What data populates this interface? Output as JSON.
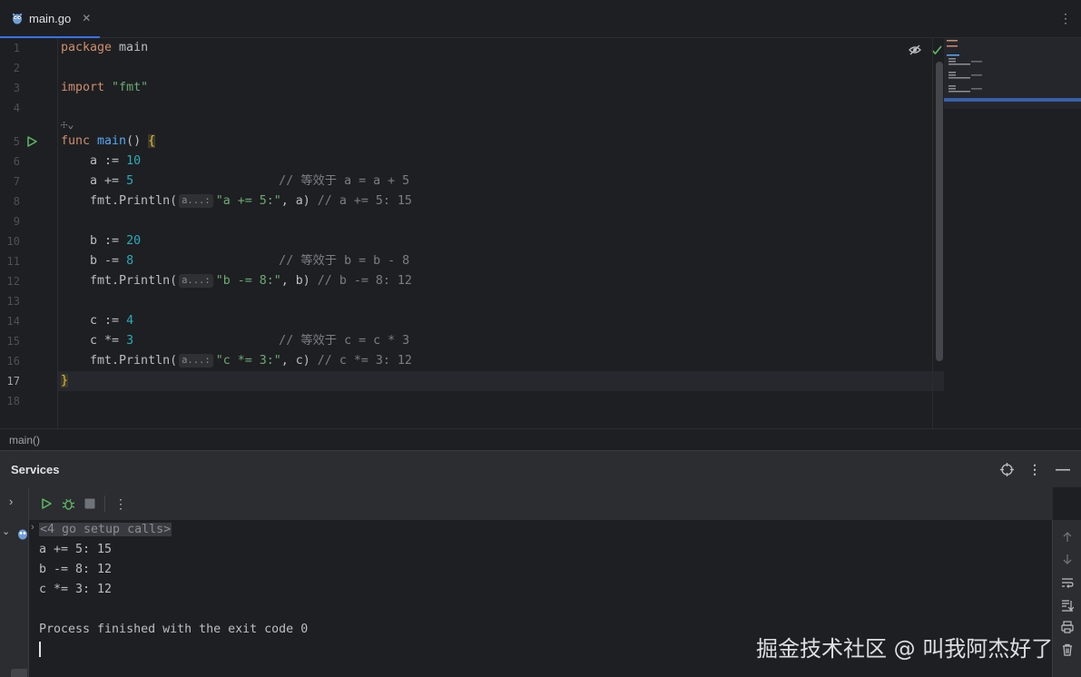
{
  "tab": {
    "filename": "main.go"
  },
  "editor": {
    "author_hint": "☩⌄",
    "lines": [
      {
        "n": "1"
      },
      {
        "n": "2"
      },
      {
        "n": "3"
      },
      {
        "n": "4"
      },
      {
        "n": "5"
      },
      {
        "n": "6"
      },
      {
        "n": "7"
      },
      {
        "n": "8"
      },
      {
        "n": "9"
      },
      {
        "n": "10"
      },
      {
        "n": "11"
      },
      {
        "n": "12"
      },
      {
        "n": "13"
      },
      {
        "n": "14"
      },
      {
        "n": "15"
      },
      {
        "n": "16"
      },
      {
        "n": "17"
      },
      {
        "n": "18"
      }
    ],
    "code": {
      "l1_kw": "package",
      "l1_name": " main",
      "l3_kw": "import",
      "l3_str": " \"fmt\"",
      "l5_kw": "func",
      "l5_fn": " main",
      "l5_rest": "() ",
      "l5_brace": "{",
      "l6_a": "    a := ",
      "l6_num": "10",
      "l7_a": "    a += ",
      "l7_num": "5",
      "l7_cmt": "                    // 等效于 a = a + 5",
      "l8_a": "    fmt.Println(",
      "l8_hint": "a...:",
      "l8_str": "\"a += 5:\"",
      "l8_b": ", a) ",
      "l8_cmt": "// a += 5: 15",
      "l10_a": "    b := ",
      "l10_num": "20",
      "l11_a": "    b -= ",
      "l11_num": "8",
      "l11_cmt": "                    // 等效于 b = b - 8",
      "l12_a": "    fmt.Println(",
      "l12_hint": "a...:",
      "l12_str": "\"b -= 8:\"",
      "l12_b": ", b) ",
      "l12_cmt": "// b -= 8: 12",
      "l14_a": "    c := ",
      "l14_num": "4",
      "l15_a": "    c *= ",
      "l15_num": "3",
      "l15_cmt": "                    // 等效于 c = c * 3",
      "l16_a": "    fmt.Println(",
      "l16_hint": "a...:",
      "l16_str": "\"c *= 3:\"",
      "l16_b": ", c) ",
      "l16_cmt": "// c *= 3: 12",
      "l17_brace": "}"
    },
    "current_line": "17"
  },
  "breadcrumb": {
    "path": "main()"
  },
  "services": {
    "title": "Services",
    "output": {
      "setup": "<4 go setup calls>",
      "line1": "a += 5: 15",
      "line2": "b -= 8: 12",
      "line3": "c *= 3: 12",
      "finish": "Process finished with the exit code 0"
    }
  },
  "watermark": "掘金技术社区 @ 叫我阿杰好了",
  "colors": {
    "accent": "#3574f0",
    "run_green": "#5fb865",
    "keyword": "#cf8e6d",
    "function": "#56a8f5",
    "number": "#2aacb8",
    "string": "#6aab73"
  }
}
